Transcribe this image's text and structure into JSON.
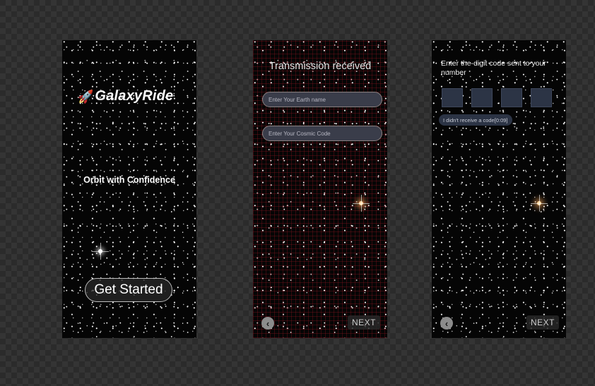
{
  "screen1": {
    "logo_text": "GalaxyRide",
    "tagline": "Orbit with Confidence",
    "cta_label": "Get Started"
  },
  "screen2": {
    "title": "Transmission received",
    "earth_name_placeholder": "Enter Your Earth name",
    "cosmic_code_placeholder": "Enter Your Cosmic Code",
    "back_symbol": "‹",
    "next_label": "NEXT"
  },
  "screen3": {
    "title": "Enter the-digit code sent to your number",
    "resend_label": "I didn't receive a code[0:09]",
    "back_symbol": "‹",
    "next_label": "NEXT"
  }
}
